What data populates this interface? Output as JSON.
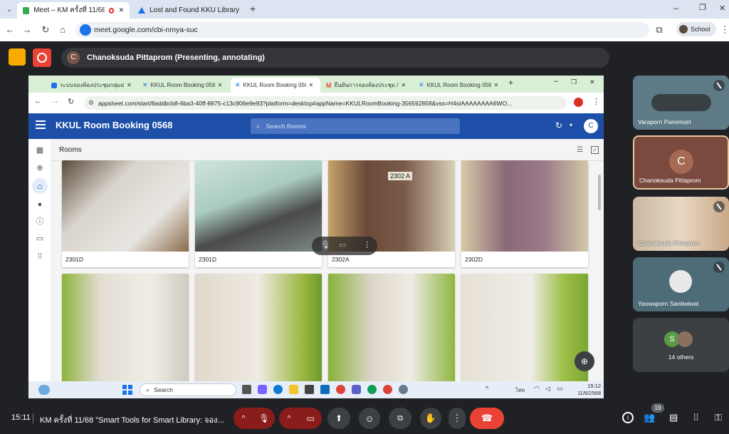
{
  "outer_browser": {
    "tabs": [
      {
        "title": "Meet – KM ครั้งที่ 11/68 \"Sm",
        "active": true
      },
      {
        "title": "Lost and Found KKU Library",
        "active": false
      }
    ],
    "new_tab": "+",
    "url": "meet.google.com/cbi-nmya-suc",
    "profile_label": "School",
    "window_min": "–",
    "window_max": "❐",
    "window_close": "✕"
  },
  "meet": {
    "presenter_initial": "C",
    "presenting_text": "Chanoksuda Pittaprom (Presenting, annotating)",
    "time": "15:11",
    "meeting_title": "KM ครั้งที่ 11/68 \"Smart Tools for Smart Library: จอง...",
    "participant_count": "19",
    "participants": [
      {
        "name": "Varaporn Panomsiri"
      },
      {
        "name": "Chanoksuda Pittaprom",
        "initial": "C"
      },
      {
        "name": "Chanoksuda Pittaprom"
      },
      {
        "name": "Yaowaporn Santiwiwat"
      },
      {
        "name": "14 others",
        "initial": "S"
      }
    ]
  },
  "shared_screen": {
    "tabs": [
      {
        "title": "ระบบจองห้องประชุมกลุ่มย่อย"
      },
      {
        "title": "KKUL Room Booking 0568"
      },
      {
        "title": "KKUL Room Booking 0568",
        "active": true
      },
      {
        "title": "ยืนยันการจองห้องประชุม / C"
      },
      {
        "title": "KKUL Room Booking 0568"
      }
    ],
    "url": "appsheet.com/start/8addbcb8-6ba3-40ff-8875-c13c906e9e93?platform=desktop#appName=KKULRoomBooking-356592858&vss=H4sIAAAAAAAA6WO...",
    "app_title": "KKUL Room Booking 0568",
    "search_placeholder": "Search Rooms",
    "avatar_initial": "C",
    "section_title": "Rooms",
    "rooms": [
      {
        "label": "2301D"
      },
      {
        "label": "2301D"
      },
      {
        "label": "2302A",
        "sign": "2302 A"
      },
      {
        "label": "2302D"
      },
      {
        "label": ""
      },
      {
        "label": ""
      },
      {
        "label": ""
      },
      {
        "label": ""
      }
    ],
    "taskbar": {
      "search": "Search",
      "lang": "ไทย",
      "clock_time": "15:12",
      "clock_date": "11/6/2568"
    }
  },
  "colors": {
    "app_header": "#1d4fa8",
    "end_call": "#ea4335",
    "record": "#ea4335",
    "activity": "#f9ab00"
  }
}
